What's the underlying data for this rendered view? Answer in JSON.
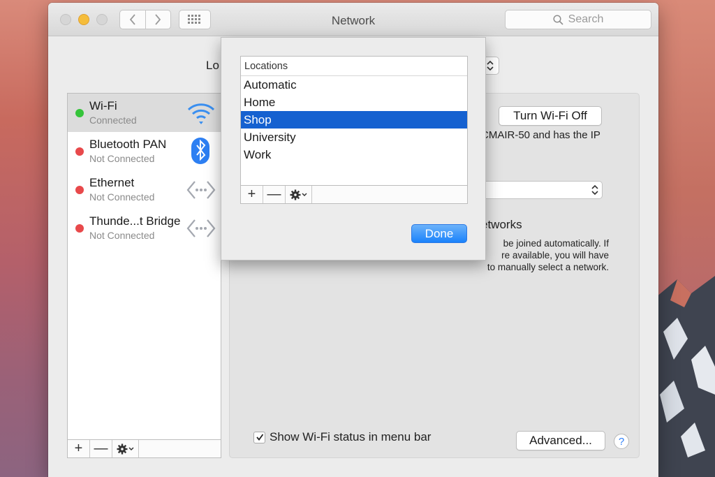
{
  "window": {
    "title": "Network"
  },
  "search": {
    "placeholder": "Search"
  },
  "location": {
    "label_partial": "Lo"
  },
  "services": [
    {
      "name": "Wi-Fi",
      "status": "Connected",
      "icon": "wifi-icon",
      "status_color": "#35c43a"
    },
    {
      "name": "Bluetooth PAN",
      "status": "Not Connected",
      "icon": "bluetooth-icon",
      "status_color": "#e8494b"
    },
    {
      "name": "Ethernet",
      "status": "Not Connected",
      "icon": "ethernet-icon",
      "status_color": "#e8494b"
    },
    {
      "name": "Thunde...t Bridge",
      "status": "Not Connected",
      "icon": "thunderbolt-bridge-icon",
      "status_color": "#e8494b"
    }
  ],
  "list_toolbar": {
    "add": "+",
    "remove": "—"
  },
  "detail": {
    "turn_off_label": "Turn Wi-Fi Off",
    "status_fragment": "CMAIR-50 and has the IP",
    "ask_label_fragment": "etworks",
    "help_text_lines": [
      "be joined automatically. If",
      "re available, you will have",
      "to manually select a network."
    ],
    "show_wifi_status_label": "Show Wi-Fi status in menu bar",
    "show_wifi_status_checked": true,
    "advanced_label": "Advanced...",
    "help_label": "?"
  },
  "locations_sheet": {
    "header": "Locations",
    "items": [
      "Automatic",
      "Home",
      "Shop",
      "University",
      "Work"
    ],
    "selected": "Shop",
    "add": "+",
    "remove": "—",
    "done_label": "Done"
  },
  "colors": {
    "accent": "#1a82fb",
    "selection": "#1561d0",
    "connected": "#35c43a",
    "disconnected": "#e8494b"
  }
}
